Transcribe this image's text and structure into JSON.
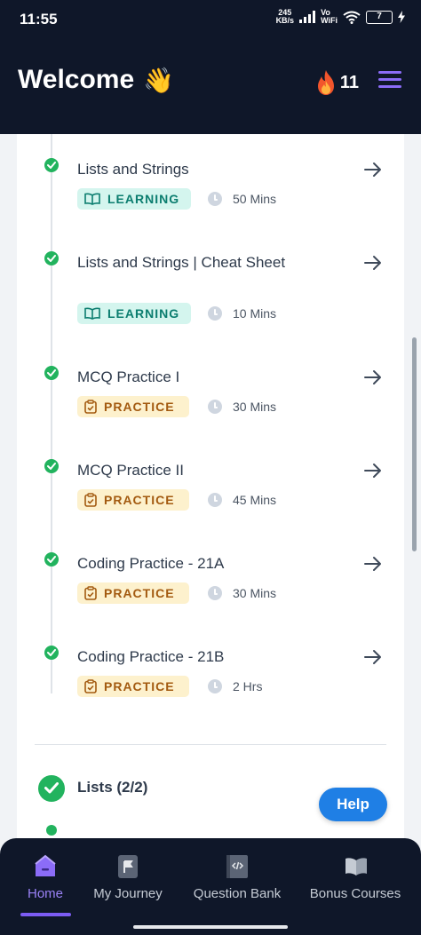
{
  "status_bar": {
    "time": "11:55",
    "speed_value": "245",
    "speed_unit": "KB/s",
    "vowifi_top": "Vo",
    "vowifi_bottom": "WiFi",
    "battery": "7"
  },
  "header": {
    "title": "Welcome",
    "wave_emoji": "👋",
    "streak_icon": "fire-icon",
    "streak_count": "11"
  },
  "items": [
    {
      "title": "Lists and Strings",
      "tag": "LEARNING",
      "duration": "50 Mins"
    },
    {
      "title": "Lists and Strings | Cheat Sheet",
      "tag": "LEARNING",
      "duration": "10 Mins"
    },
    {
      "title": "MCQ Practice I",
      "tag": "PRACTICE",
      "duration": "30 Mins"
    },
    {
      "title": "MCQ Practice II",
      "tag": "PRACTICE",
      "duration": "45 Mins"
    },
    {
      "title": "Coding Practice - 21A",
      "tag": "PRACTICE",
      "duration": "30 Mins"
    },
    {
      "title": "Coding Practice - 21B",
      "tag": "PRACTICE",
      "duration": "2 Hrs"
    }
  ],
  "section": {
    "title": "Lists (2/2)"
  },
  "help_label": "Help",
  "nav": [
    {
      "label": "Home",
      "icon": "home-icon",
      "active": true
    },
    {
      "label": "My Journey",
      "icon": "flag-icon",
      "active": false
    },
    {
      "label": "Question Bank",
      "icon": "code-book-icon",
      "active": false
    },
    {
      "label": "Bonus Courses",
      "icon": "open-book-icon",
      "active": false
    }
  ],
  "colors": {
    "header_bg": "#0f1729",
    "accent": "#8b6cf7",
    "success": "#22b35e",
    "learning_bg": "#d4f5ee",
    "learning_text": "#0b7d6f",
    "practice_bg": "#fdf1cd",
    "practice_text": "#a35a10",
    "help_button": "#1f7fe5"
  }
}
